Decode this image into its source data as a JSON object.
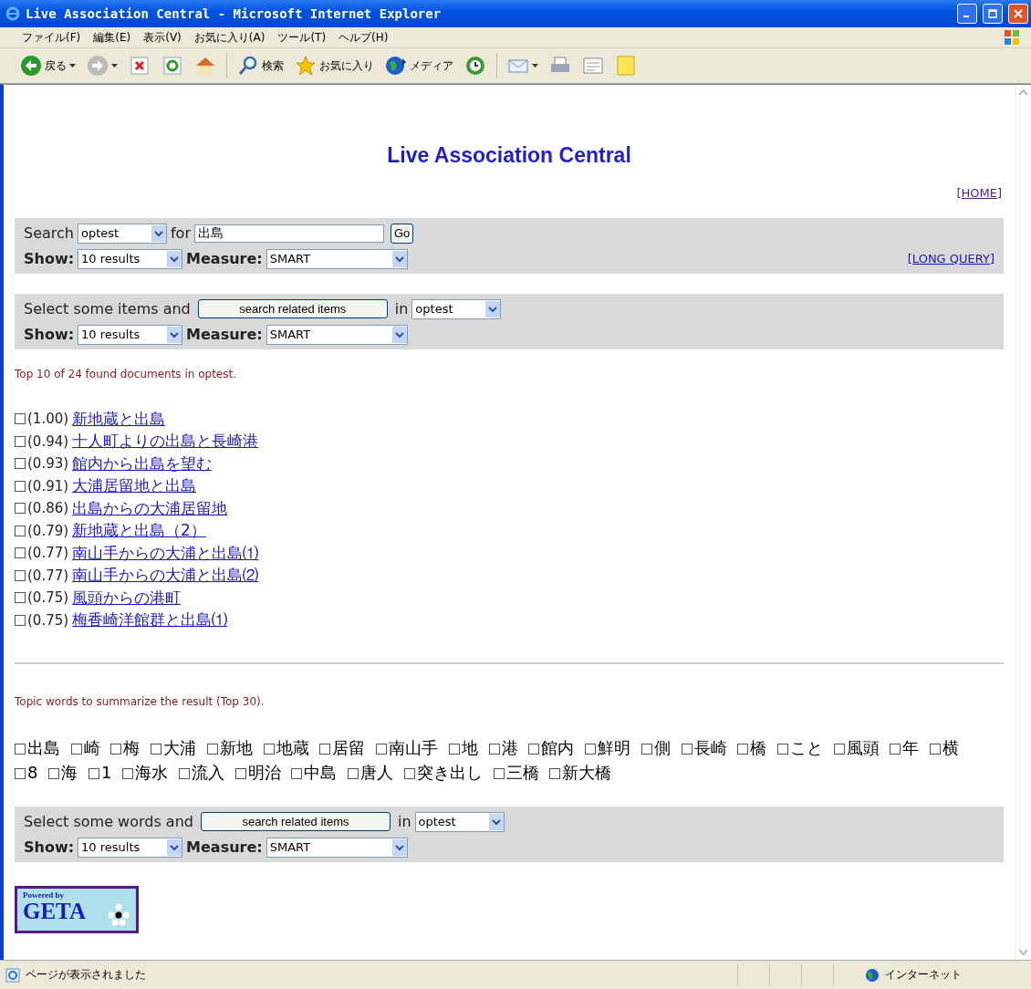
{
  "window": {
    "title": "Live Association Central - Microsoft Internet Explorer"
  },
  "menu": [
    "ファイル(F)",
    "編集(E)",
    "表示(V)",
    "お気に入り(A)",
    "ツール(T)",
    "ヘルプ(H)"
  ],
  "toolbar": [
    {
      "kind": "back",
      "label": "戻る"
    },
    {
      "kind": "forward"
    },
    {
      "kind": "stop"
    },
    {
      "kind": "refresh"
    },
    {
      "kind": "home"
    },
    {
      "kind": "search",
      "label": "検索"
    },
    {
      "kind": "favorites",
      "label": "お気に入り"
    },
    {
      "kind": "media",
      "label": "メディア"
    },
    {
      "kind": "history"
    },
    {
      "kind": "mail"
    },
    {
      "kind": "print"
    },
    {
      "kind": "edit"
    },
    {
      "kind": "note"
    }
  ],
  "page": {
    "heading": "Live Association Central",
    "home_link": "[HOME]",
    "search_panel": {
      "label": "Search",
      "source": "optest",
      "for_label": "for",
      "query": "出島",
      "go": "Go",
      "show_label": "Show:",
      "show_value": "10 results",
      "measure_label": "Measure:",
      "measure_value": "SMART",
      "long_query": "[LONG QUERY]"
    },
    "items_panel": {
      "prefix": "Select some items and",
      "button": "search related items",
      "in_label": "in",
      "source": "optest",
      "show_label": "Show:",
      "show_value": "10 results",
      "measure_label": "Measure:",
      "measure_value": "SMART"
    },
    "result_summary": "Top 10 of 24 found documents in optest.",
    "results": [
      {
        "score": "(1.00)",
        "title": "新地蔵と出島",
        "checked": false
      },
      {
        "score": "(0.94)",
        "title": "十人町よりの出島と長崎港",
        "checked": false
      },
      {
        "score": "(0.93)",
        "title": "館内から出島を望む",
        "checked": false
      },
      {
        "score": "(0.91)",
        "title": "大浦居留地と出島",
        "checked": false
      },
      {
        "score": "(0.86)",
        "title": "出島からの大浦居留地",
        "checked": false
      },
      {
        "score": "(0.79)",
        "title": "新地蔵と出島（2）",
        "checked": false
      },
      {
        "score": "(0.77)",
        "title": "南山手からの大浦と出島⑴",
        "checked": false
      },
      {
        "score": "(0.77)",
        "title": "南山手からの大浦と出島⑵",
        "checked": false
      },
      {
        "score": "(0.75)",
        "title": "風頭からの港町",
        "checked": false
      },
      {
        "score": "(0.75)",
        "title": "梅香崎洋館群と出島⑴",
        "checked": false
      }
    ],
    "topic_summary": "Topic words to summarize the result (Top 30).",
    "topic_words": [
      {
        "word": "出島",
        "checked": false
      },
      {
        "word": "崎",
        "checked": false
      },
      {
        "word": "梅",
        "checked": false
      },
      {
        "word": "大浦",
        "checked": false
      },
      {
        "word": "新地",
        "checked": false
      },
      {
        "word": "地蔵",
        "checked": false
      },
      {
        "word": "居留",
        "checked": false
      },
      {
        "word": "南山手",
        "checked": false
      },
      {
        "word": "地",
        "checked": false
      },
      {
        "word": "港",
        "checked": false
      },
      {
        "word": "館内",
        "checked": false
      },
      {
        "word": "鮮明",
        "checked": false
      },
      {
        "word": "側",
        "checked": false
      },
      {
        "word": "長崎",
        "checked": false
      },
      {
        "word": "橋",
        "checked": false
      },
      {
        "word": "こと",
        "checked": false
      },
      {
        "word": "風頭",
        "checked": false
      },
      {
        "word": "年",
        "checked": false
      },
      {
        "word": "横",
        "checked": false
      },
      {
        "word": "8",
        "checked": false
      },
      {
        "word": "海",
        "checked": false
      },
      {
        "word": "1",
        "checked": false
      },
      {
        "word": "海水",
        "checked": false
      },
      {
        "word": "流入",
        "checked": false
      },
      {
        "word": "明治",
        "checked": false
      },
      {
        "word": "中島",
        "checked": false
      },
      {
        "word": "唐人",
        "checked": false
      },
      {
        "word": "突き出し",
        "checked": false
      },
      {
        "word": "三橋",
        "checked": false
      },
      {
        "word": "新大橋",
        "checked": false
      }
    ],
    "words_panel": {
      "prefix": "Select some words and",
      "button": "search related items",
      "in_label": "in",
      "source": "optest",
      "show_label": "Show:",
      "show_value": "10 results",
      "measure_label": "Measure:",
      "measure_value": "SMART"
    },
    "logo": {
      "small": "Powered by",
      "big": "GETA"
    }
  },
  "status_bar": {
    "message": "ページが表示されました",
    "zone": "インターネット"
  }
}
